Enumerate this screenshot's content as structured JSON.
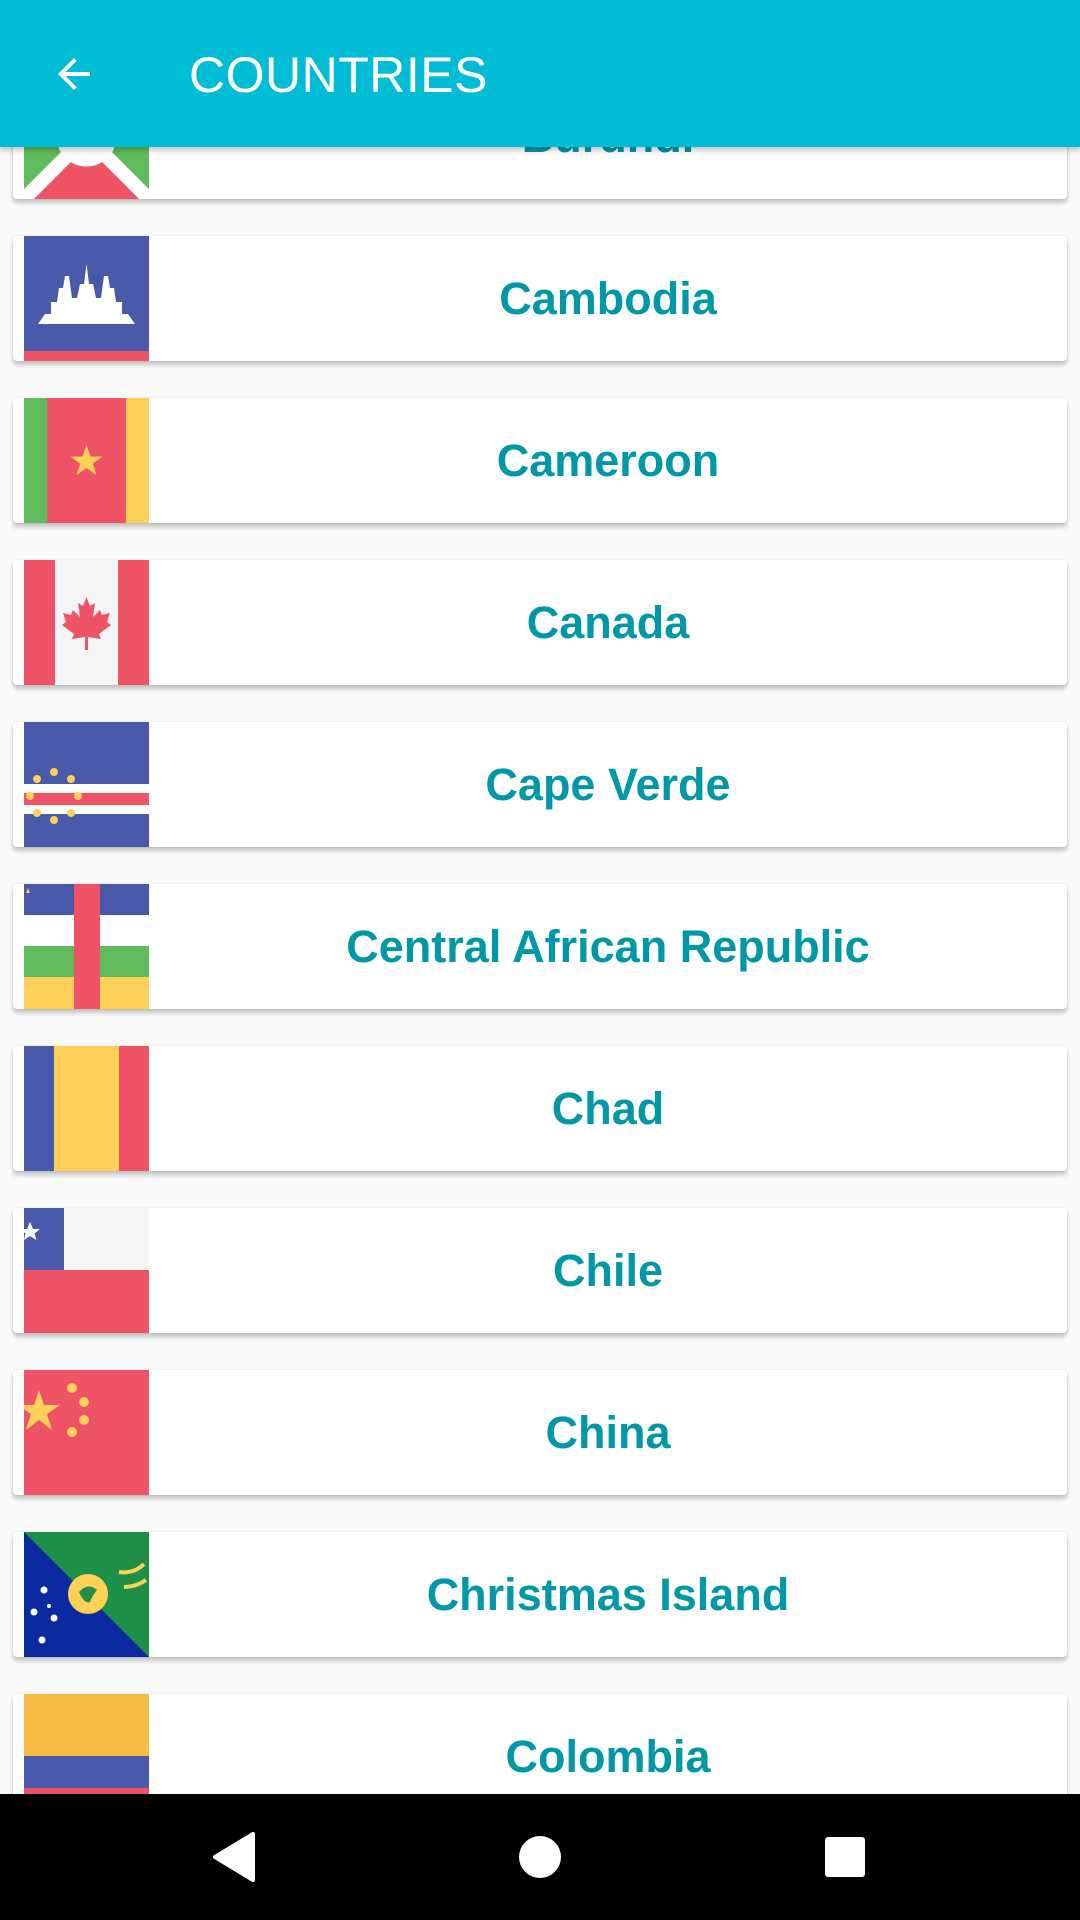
{
  "app_bar": {
    "title": "COUNTRIES",
    "back_icon": "arrow-back-icon",
    "background_color": "#00bcd4"
  },
  "countries": [
    {
      "name": "Burundi",
      "flag_icon": "burundi-flag-icon"
    },
    {
      "name": "Cambodia",
      "flag_icon": "cambodia-flag-icon"
    },
    {
      "name": "Cameroon",
      "flag_icon": "cameroon-flag-icon"
    },
    {
      "name": "Canada",
      "flag_icon": "canada-flag-icon"
    },
    {
      "name": "Cape Verde",
      "flag_icon": "cape-verde-flag-icon"
    },
    {
      "name": "Central African Republic",
      "flag_icon": "central-african-republic-flag-icon"
    },
    {
      "name": "Chad",
      "flag_icon": "chad-flag-icon"
    },
    {
      "name": "Chile",
      "flag_icon": "chile-flag-icon"
    },
    {
      "name": "China",
      "flag_icon": "china-flag-icon"
    },
    {
      "name": "Christmas Island",
      "flag_icon": "christmas-island-flag-icon"
    },
    {
      "name": "Colombia",
      "flag_icon": "colombia-flag-icon"
    }
  ],
  "colors": {
    "country_text": "#0097a7",
    "flag_red": "#ef5466",
    "flag_blue": "#4a5aab",
    "flag_yellow": "#fdd058",
    "flag_green": "#5fbb5b"
  },
  "nav_bar": {
    "back_icon": "nav-back-triangle-icon",
    "home_icon": "nav-home-circle-icon",
    "recents_icon": "nav-recents-square-icon"
  }
}
